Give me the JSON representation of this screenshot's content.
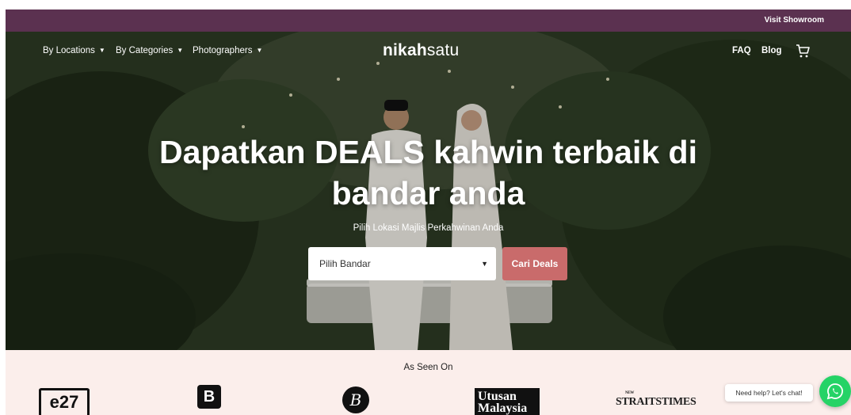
{
  "topbar": {
    "link": "Visit Showroom"
  },
  "nav": {
    "items": [
      {
        "label": "By Locations"
      },
      {
        "label": "By Categories"
      },
      {
        "label": "Photographers"
      }
    ],
    "logo_bold": "nikah",
    "logo_light": "satu",
    "faq": "FAQ",
    "blog": "Blog",
    "cart_icon": "cart-icon"
  },
  "hero": {
    "headline_line1": "Dapatkan DEALS kahwin terbaik di",
    "headline_line2": "bandar anda",
    "subhead": "Pilih Lokasi Majlis Perkahwinan Anda",
    "select_value": "Pilih Bandar",
    "cta": "Cari Deals"
  },
  "press": {
    "title": "As Seen On",
    "logos": [
      "e27",
      "B",
      "B",
      "Utusan Malaysia",
      "STRAITS TIMES",
      ""
    ],
    "utusan_line1": "Utusan",
    "utusan_line2": "Malaysia",
    "straits_small": "NEW",
    "straits": "STRAITSTIMES"
  },
  "chat": {
    "bubble": "Need help? Let's chat!",
    "icon": "whatsapp-icon"
  },
  "colors": {
    "topbar": "#5b3150",
    "cta": "#c96b6b",
    "press_bg": "#fbeeeb",
    "whatsapp": "#25d366"
  }
}
